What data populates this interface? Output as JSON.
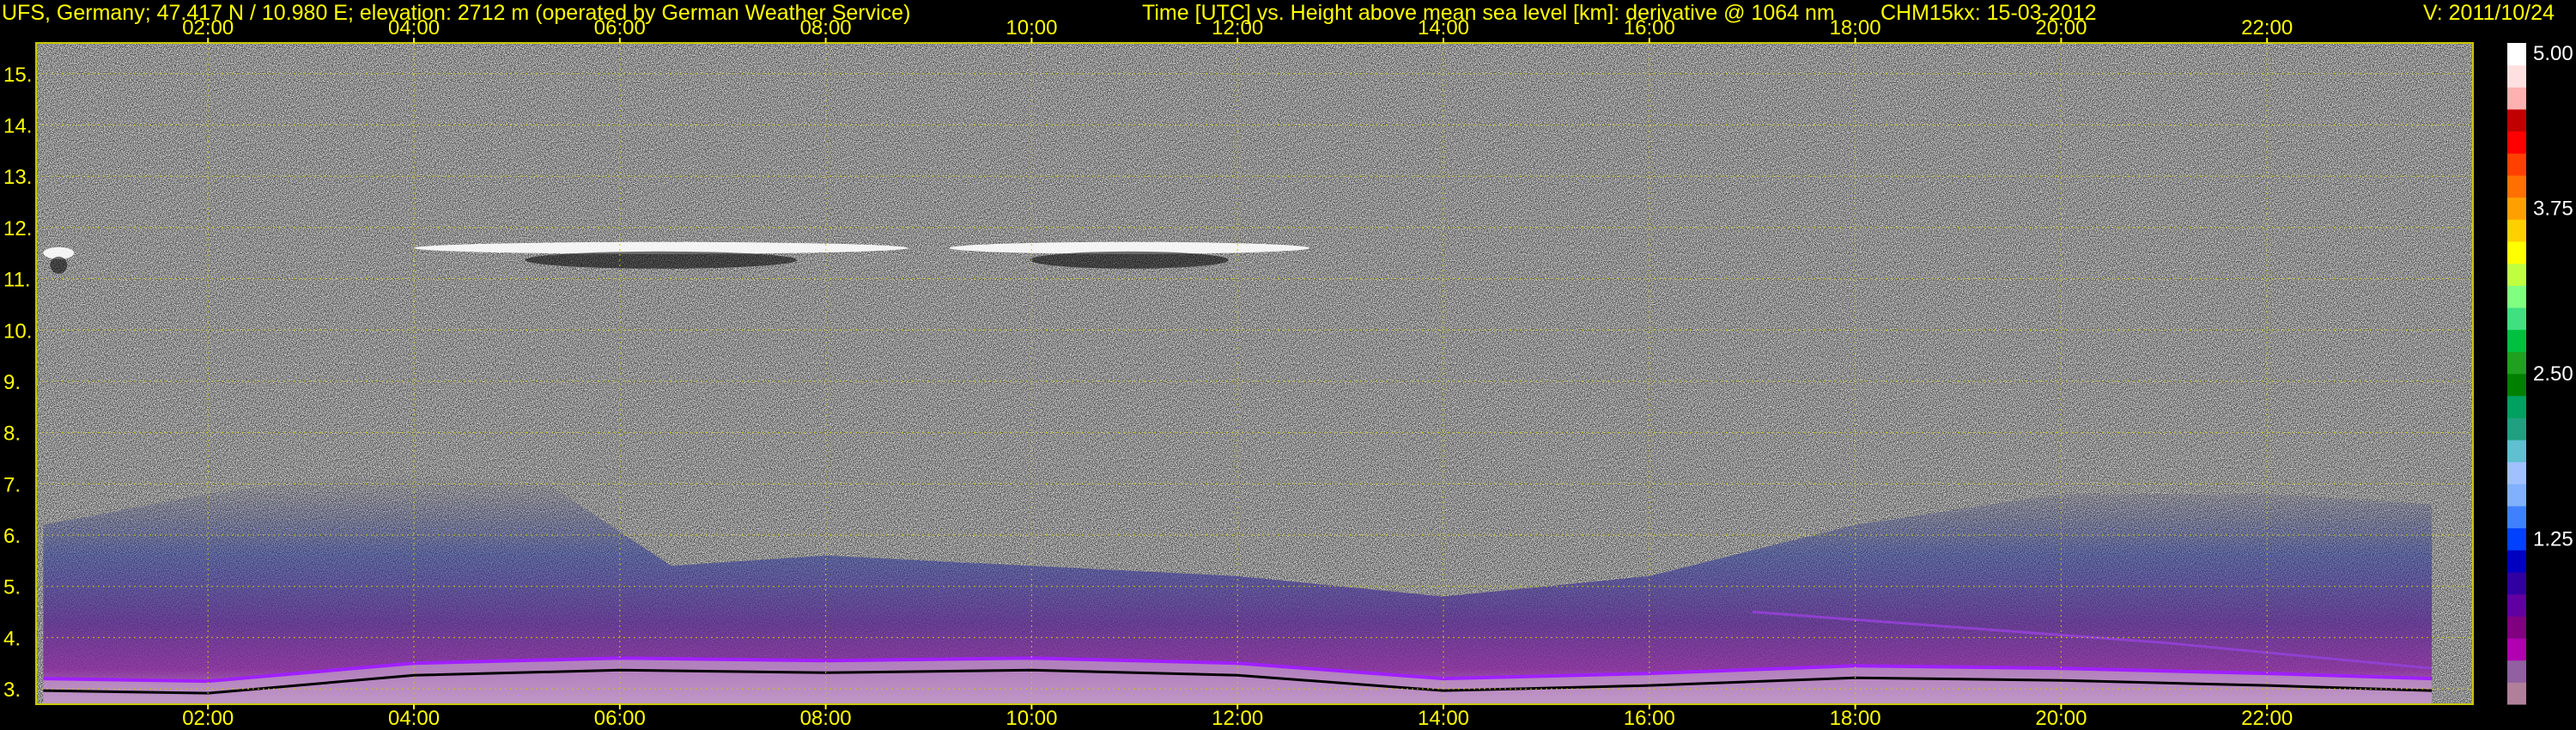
{
  "header": {
    "site_info": "UFS, Germany; 47.417 N / 10.980 E; elevation: 2712 m  (operated by German Weather Service)",
    "axis_description": "Time [UTC] vs. Height above mean sea level [km]: derivative @ 1064 nm",
    "instrument_date": "CHM15kx: 15-03-2012",
    "version": "V: 2011/10/24"
  },
  "chart_data": {
    "type": "heatmap",
    "x_axis": {
      "unit": "UTC",
      "range": [
        0.33,
        24.0
      ],
      "ticks": [
        "02:00",
        "04:00",
        "06:00",
        "08:00",
        "10:00",
        "12:00",
        "14:00",
        "16:00",
        "18:00",
        "20:00",
        "22:00"
      ],
      "tick_values": [
        2,
        4,
        6,
        8,
        10,
        12,
        14,
        16,
        18,
        20,
        22
      ]
    },
    "y_axis": {
      "unit": "km",
      "range": [
        2.7,
        15.6
      ],
      "ticks": [
        "3.",
        "4.",
        "5.",
        "6.",
        "7.",
        "8.",
        "9.",
        "10.",
        "11.",
        "12.",
        "13.",
        "14.",
        "15."
      ],
      "tick_values": [
        3,
        4,
        5,
        6,
        7,
        8,
        9,
        10,
        11,
        12,
        13,
        14,
        15
      ]
    },
    "grid": true,
    "colorbar": {
      "range": [
        0,
        5.0
      ],
      "labels": [
        "5.00",
        "3.75",
        "2.50",
        "1.25"
      ],
      "label_values": [
        5.0,
        3.75,
        2.5,
        1.25
      ],
      "colors": [
        "#b0809a",
        "#9060a0",
        "#b000b0",
        "#800080",
        "#6000a0",
        "#3000a0",
        "#0000c0",
        "#0040ff",
        "#4080ff",
        "#80b0ff",
        "#a0c0ff",
        "#60c0d0",
        "#20a080",
        "#00a060",
        "#008000",
        "#20a020",
        "#00c040",
        "#40e080",
        "#80ff80",
        "#c0ff40",
        "#ffff00",
        "#ffd000",
        "#ffa000",
        "#ff7000",
        "#ff4000",
        "#ff0000",
        "#c00000",
        "#ffb0b0",
        "#ffe0e0",
        "#ffffff"
      ]
    },
    "cloud_layers": [
      {
        "start": 0.4,
        "end": 0.7,
        "height_km": 11.5
      },
      {
        "start": 4.0,
        "end": 8.8,
        "height_km": 11.6
      },
      {
        "start": 9.2,
        "end": 12.7,
        "height_km": 11.6
      }
    ],
    "aerosol_layer_top_km": [
      {
        "time": 0.4,
        "km": 6.2
      },
      {
        "time": 2.0,
        "km": 6.8
      },
      {
        "time": 3.5,
        "km": 7.2
      },
      {
        "time": 5.3,
        "km": 7.0
      },
      {
        "time": 6.5,
        "km": 5.4
      },
      {
        "time": 8.0,
        "km": 5.6
      },
      {
        "time": 10.0,
        "km": 5.4
      },
      {
        "time": 12.0,
        "km": 5.2
      },
      {
        "time": 14.0,
        "km": 4.8
      },
      {
        "time": 16.0,
        "km": 5.2
      },
      {
        "time": 18.0,
        "km": 6.2
      },
      {
        "time": 20.0,
        "km": 6.8
      },
      {
        "time": 22.0,
        "km": 6.8
      },
      {
        "time": 23.6,
        "km": 6.6
      }
    ],
    "boundary_layer_km": [
      {
        "time": 0.4,
        "km": 3.2
      },
      {
        "time": 2.0,
        "km": 3.15
      },
      {
        "time": 4.0,
        "km": 3.5
      },
      {
        "time": 6.0,
        "km": 3.6
      },
      {
        "time": 8.0,
        "km": 3.55
      },
      {
        "time": 10.0,
        "km": 3.6
      },
      {
        "time": 12.0,
        "km": 3.5
      },
      {
        "time": 14.0,
        "km": 3.2
      },
      {
        "time": 16.0,
        "km": 3.3
      },
      {
        "time": 18.0,
        "km": 3.45
      },
      {
        "time": 20.0,
        "km": 3.4
      },
      {
        "time": 22.0,
        "km": 3.3
      },
      {
        "time": 23.6,
        "km": 3.2
      }
    ],
    "residual_layer_km": [
      {
        "time": 17.0,
        "km": 4.5
      },
      {
        "time": 19.0,
        "km": 4.2
      },
      {
        "time": 21.0,
        "km": 3.9
      },
      {
        "time": 23.6,
        "km": 3.4
      }
    ]
  }
}
